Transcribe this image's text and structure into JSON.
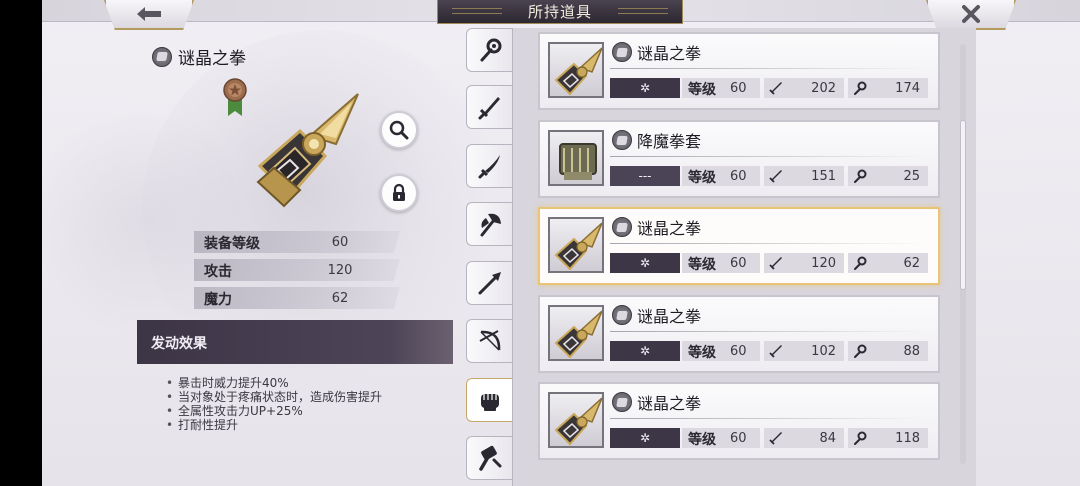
{
  "header": {
    "title": "所持道具"
  },
  "detail": {
    "item_name": "谜晶之拳",
    "stats": [
      {
        "label": "装备等级",
        "value": "60"
      },
      {
        "label": "攻击",
        "value": "120"
      },
      {
        "label": "魔力",
        "value": "62"
      }
    ],
    "effect_title": "发动效果",
    "effects": [
      "暴击时威力提升40%",
      "当对象处于疼痛状态时，造成伤害提升",
      "全属性攻击力UP+25%",
      "打耐性提升"
    ]
  },
  "tabs": [
    {
      "icon": "wand-icon",
      "active": false
    },
    {
      "icon": "sword-icon",
      "active": false
    },
    {
      "icon": "katana-icon",
      "active": false
    },
    {
      "icon": "axe-icon",
      "active": false
    },
    {
      "icon": "spear-icon",
      "active": false
    },
    {
      "icon": "bow-icon",
      "active": false
    },
    {
      "icon": "fist-icon",
      "active": true
    },
    {
      "icon": "hammer-icon",
      "active": false
    }
  ],
  "items": [
    {
      "name": "谜晶之拳",
      "element": "✲",
      "level_label": "等级",
      "level": "60",
      "attack": "202",
      "magic": "174",
      "selected": false
    },
    {
      "name": "降魔拳套",
      "element": "---",
      "level_label": "等级",
      "level": "60",
      "attack": "151",
      "magic": "25",
      "selected": false
    },
    {
      "name": "谜晶之拳",
      "element": "✲",
      "level_label": "等级",
      "level": "60",
      "attack": "120",
      "magic": "62",
      "selected": true
    },
    {
      "name": "谜晶之拳",
      "element": "✲",
      "level_label": "等级",
      "level": "60",
      "attack": "102",
      "magic": "88",
      "selected": false
    },
    {
      "name": "谜晶之拳",
      "element": "✲",
      "level_label": "等级",
      "level": "60",
      "attack": "84",
      "magic": "118",
      "selected": false
    }
  ],
  "colors": {
    "accent_gold": "#e8c477",
    "dark_plate": "#3d3647"
  }
}
